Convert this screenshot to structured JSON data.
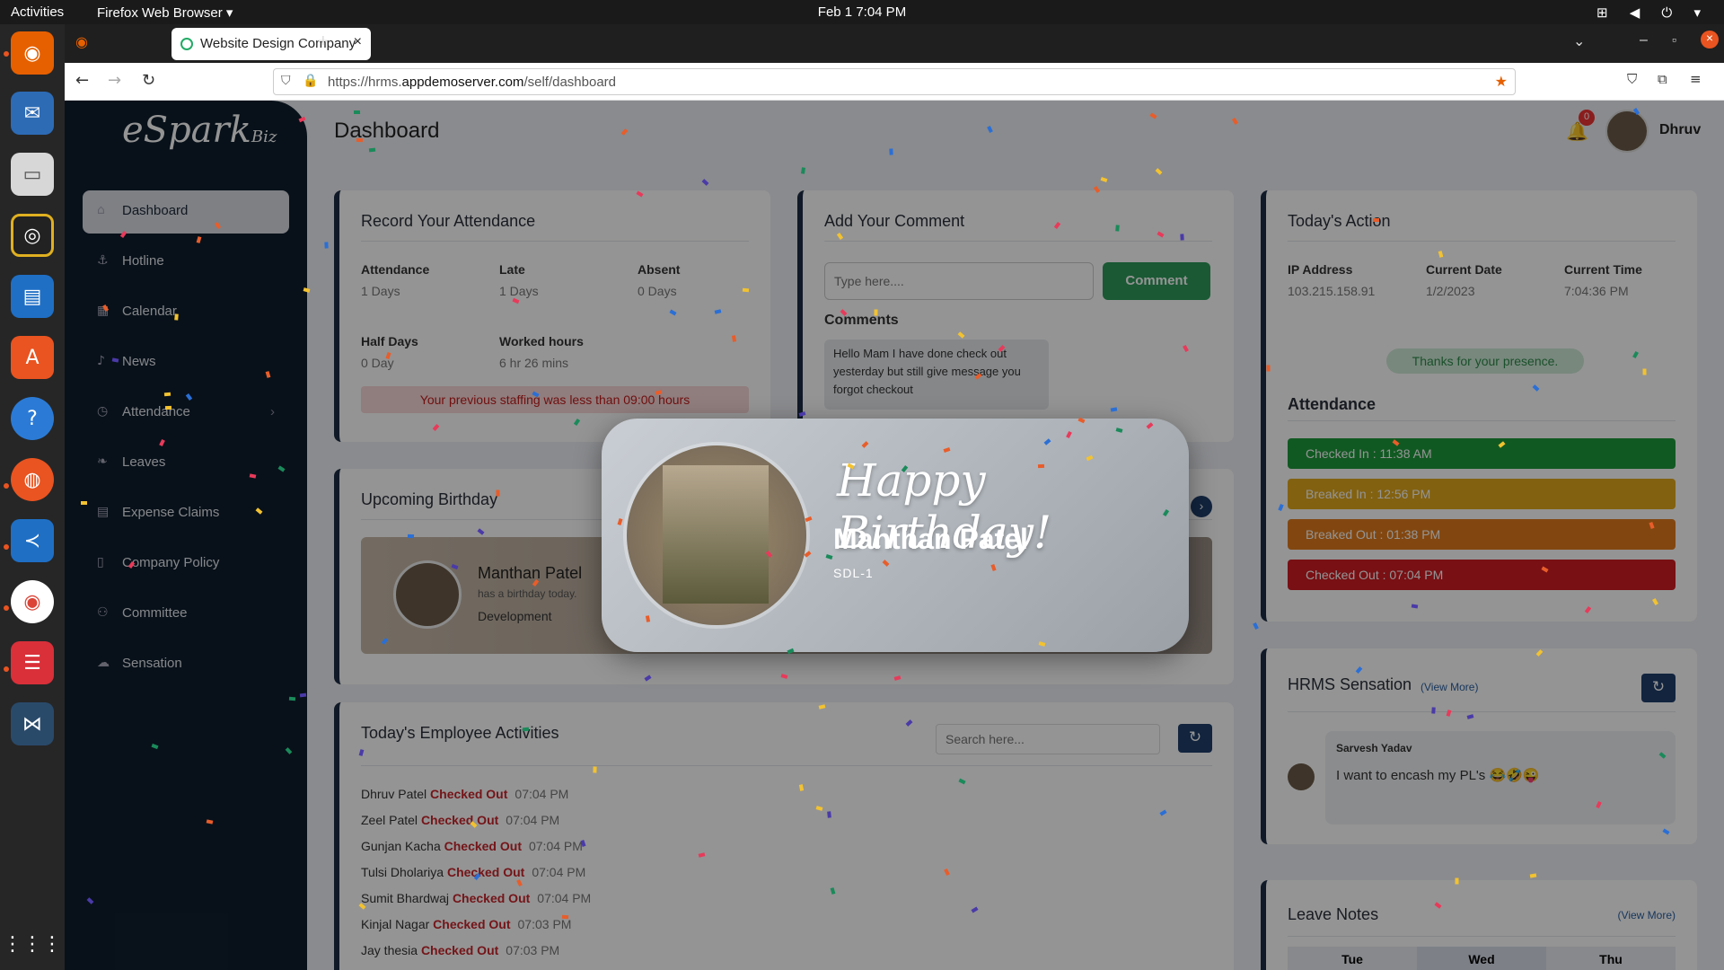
{
  "system": {
    "activities": "Activities",
    "app_menu": "Firefox Web Browser",
    "clock": "Feb 1  7:04 PM"
  },
  "browser": {
    "tab_title": "Website Design Company",
    "url_prefix": "https://hrms.",
    "url_domain": "appdemoserver.com",
    "url_path": "/self/dashboard"
  },
  "header": {
    "title": "Dashboard",
    "notification_count": "0",
    "user_name": "Dhruv"
  },
  "sidebar": {
    "logo": "eSpark",
    "logo_suffix": "Biz",
    "items": [
      {
        "label": "Dashboard",
        "icon": "home-icon"
      },
      {
        "label": "Hotline",
        "icon": "hotline-icon"
      },
      {
        "label": "Calendar",
        "icon": "calendar-icon"
      },
      {
        "label": "News",
        "icon": "bell-icon"
      },
      {
        "label": "Attendance",
        "icon": "clock-icon"
      },
      {
        "label": "Leaves",
        "icon": "leaf-icon"
      },
      {
        "label": "Expense Claims",
        "icon": "receipt-icon"
      },
      {
        "label": "Company Policy",
        "icon": "document-icon"
      },
      {
        "label": "Committee",
        "icon": "group-icon"
      },
      {
        "label": "Sensation",
        "icon": "chat-icon"
      }
    ]
  },
  "attendance_card": {
    "title": "Record Your Attendance",
    "attendance_label": "Attendance",
    "attendance_value": "1 Days",
    "late_label": "Late",
    "late_value": "1 Days",
    "absent_label": "Absent",
    "absent_value": "0 Days",
    "half_label": "Half Days",
    "half_value": "0 Day",
    "worked_label": "Worked hours",
    "worked_value": "6 hr 26 mins",
    "warning": "Your previous staffing was less than 09:00 hours"
  },
  "comment_card": {
    "title": "Add Your Comment",
    "placeholder": "Type here....",
    "button": "Comment",
    "comments_label": "Comments",
    "comment_text": "Hello Mam I have done check out yesterday but still give message you forgot checkout"
  },
  "action_card": {
    "title": "Today's Action",
    "ip_label": "IP Address",
    "ip_value": "103.215.158.91",
    "date_label": "Current Date",
    "date_value": "1/2/2023",
    "time_label": "Current Time",
    "time_value": "7:04:36 PM",
    "presence": "Thanks for your presence.",
    "attendance_title": "Attendance",
    "statuses": [
      {
        "text": "Checked In : 11:38 AM",
        "color": "#1e9a3c"
      },
      {
        "text": "Breaked In : 12:56 PM",
        "color": "#e0a81c"
      },
      {
        "text": "Breaked Out : 01:38 PM",
        "color": "#e07b1c"
      },
      {
        "text": "Checked Out : 07:04 PM",
        "color": "#cf1c24"
      }
    ]
  },
  "birthday_card": {
    "title": "Upcoming Birthday",
    "name": "Manthan Patel",
    "sub": "has a birthday today.",
    "dept": "Development"
  },
  "activities_card": {
    "title": "Today's Employee Activities",
    "search_placeholder": "Search here...",
    "rows": [
      {
        "name": "Dhruv Patel",
        "status": "Checked Out",
        "time": "07:04 PM"
      },
      {
        "name": "Zeel Patel",
        "status": "Checked Out",
        "time": "07:04 PM"
      },
      {
        "name": "Gunjan Kacha",
        "status": "Checked Out",
        "time": "07:04 PM"
      },
      {
        "name": "Tulsi Dholariya",
        "status": "Checked Out",
        "time": "07:04 PM"
      },
      {
        "name": "Sumit Bhardwaj",
        "status": "Checked Out",
        "time": "07:04 PM"
      },
      {
        "name": "Kinjal Nagar",
        "status": "Checked Out",
        "time": "07:03 PM"
      },
      {
        "name": "Jay thesia",
        "status": "Checked Out",
        "time": "07:03 PM"
      }
    ]
  },
  "sensation_card": {
    "title": "HRMS Sensation",
    "view_more": "(View More)",
    "author": "Sarvesh Yadav",
    "text": "I want to encash my PL's 😂🤣😜"
  },
  "leave_card": {
    "title": "Leave Notes",
    "view_more": "(View More)",
    "days": [
      "Tue",
      "Wed",
      "Thu"
    ]
  },
  "popup": {
    "greeting": "Happy Birthday!",
    "name": "Manthan Patel",
    "code": "SDL-1"
  }
}
